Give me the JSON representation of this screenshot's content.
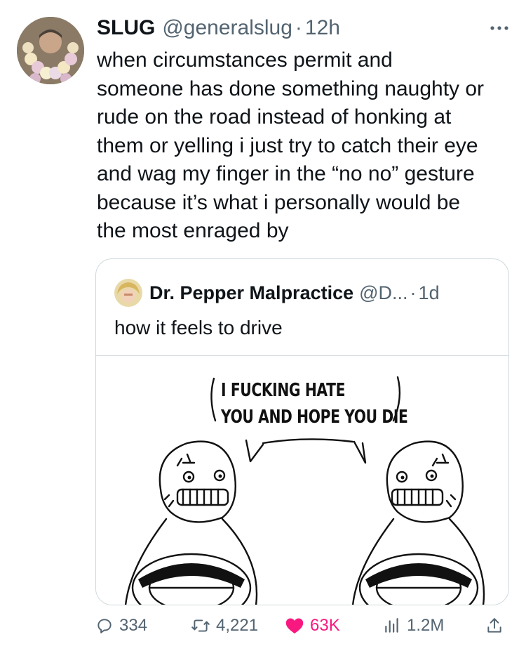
{
  "tweet": {
    "author_name": "SLUG",
    "author_handle": "@generalslug",
    "separator": "·",
    "time": "12h",
    "text": "when circumstances permit and\nsomeone has done something naughty or\nrude on the road instead of honking at\nthem or yelling i just try to catch their eye\nand wag my finger in the “no no” gesture\nbecause it’s what i personally would be\nthe most enraged by"
  },
  "quote": {
    "author_name": "Dr. Pepper Malpractice",
    "author_handle": "@D...",
    "separator": "·",
    "time": "1d",
    "text": "how it feels to drive",
    "meme_lines": [
      "I FUCKING HATE",
      "YOU AND HOPE YOU DIE"
    ]
  },
  "actions": {
    "reply_count": "334",
    "retweet_count": "4,221",
    "like_count": "63K",
    "view_count": "1.2M"
  },
  "icons": {
    "more": "more-horizontal-icon",
    "reply": "reply-icon",
    "retweet": "retweet-icon",
    "like": "heart-filled-icon",
    "views": "analytics-icon",
    "share": "share-icon"
  },
  "colors": {
    "text": "#0f1419",
    "secondary": "#536471",
    "border": "#cfd9de",
    "like": "#f91880"
  }
}
